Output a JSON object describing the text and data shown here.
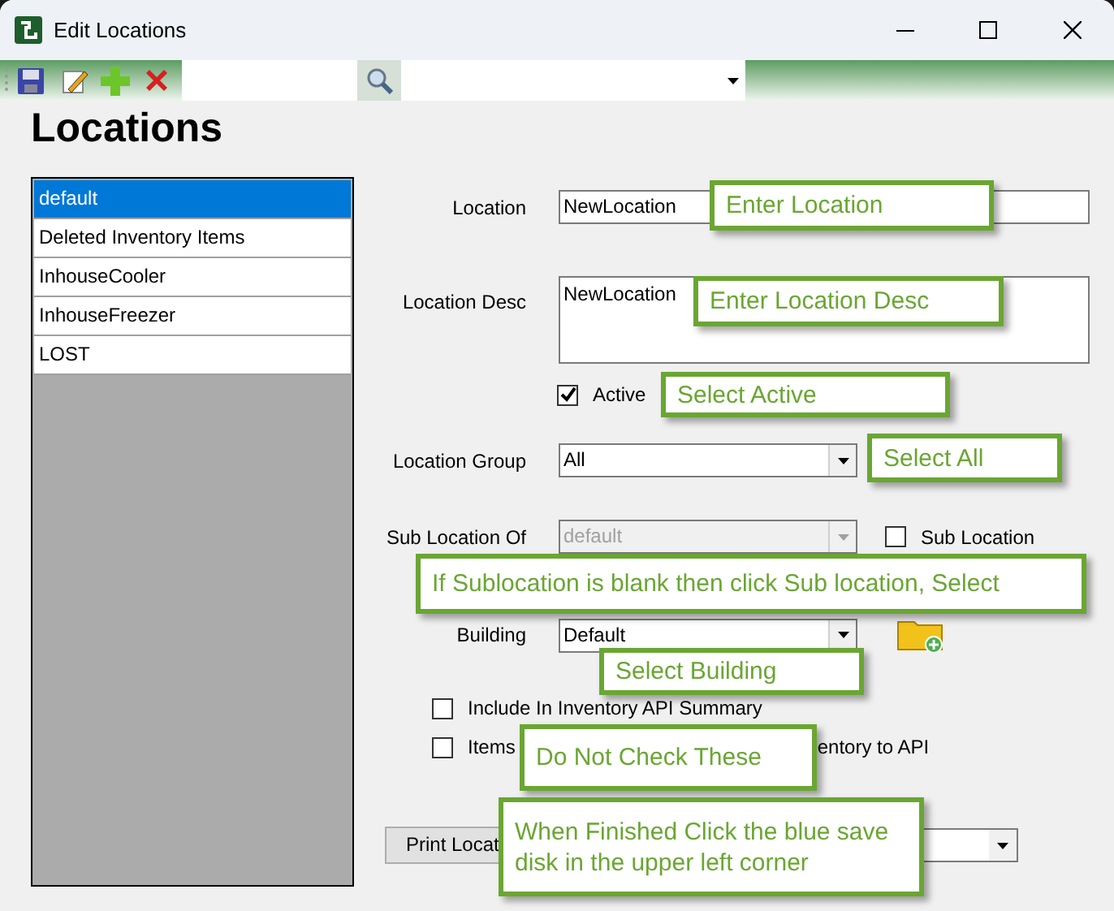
{
  "window": {
    "title": "Edit Locations"
  },
  "heading": "Locations",
  "locations": [
    {
      "label": "default",
      "selected": true
    },
    {
      "label": "Deleted Inventory Items",
      "selected": false
    },
    {
      "label": "InhouseCooler",
      "selected": false
    },
    {
      "label": "InhouseFreezer",
      "selected": false
    },
    {
      "label": "LOST",
      "selected": false
    }
  ],
  "form": {
    "location": {
      "label": "Location",
      "value": "NewLocation"
    },
    "location_desc": {
      "label": "Location Desc",
      "value": "NewLocation"
    },
    "active": {
      "label": "Active",
      "checked": true
    },
    "location_group": {
      "label": "Location Group",
      "value": "All"
    },
    "sub_location_of": {
      "label": "Sub Location Of",
      "value": "default",
      "disabled": true
    },
    "sub_location": {
      "label": "Sub Location",
      "checked": false
    },
    "building": {
      "label": "Building",
      "value": "Default"
    },
    "include_summary": {
      "label": "Include In Inventory API Summary",
      "checked": false
    },
    "items_option": {
      "label_start": "Items",
      "label_end": "entory to API",
      "checked": false
    },
    "print_button": "Print Locat"
  },
  "callouts": [
    "Enter Location",
    "Enter Location Desc",
    "Select Active",
    "Select All",
    "If Sublocation is blank then click Sub location, Select",
    "Select Building",
    "Do Not Check These",
    "When Finished Click the blue save disk in the upper left corner"
  ]
}
